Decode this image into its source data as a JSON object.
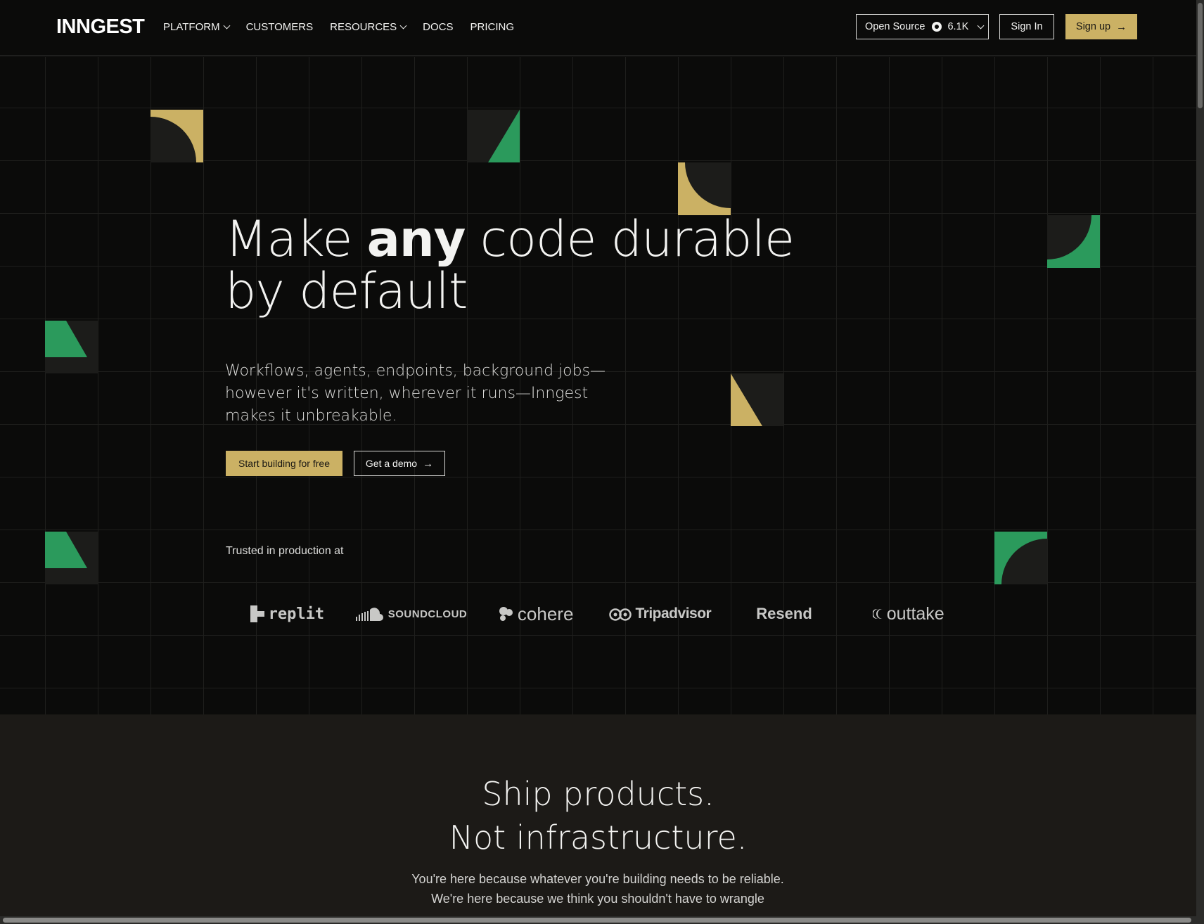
{
  "colors": {
    "gold": "#cbb164",
    "green": "#2b9a5c",
    "tile_dark": "#1c1c1a",
    "page_bg": "#0b0b0a",
    "section_bg": "#1c1a17"
  },
  "nav": {
    "logo": "INNGEST",
    "links": [
      {
        "label": "PLATFORM",
        "dropdown": true
      },
      {
        "label": "CUSTOMERS",
        "dropdown": false
      },
      {
        "label": "RESOURCES",
        "dropdown": true
      },
      {
        "label": "DOCS",
        "dropdown": false
      },
      {
        "label": "PRICING",
        "dropdown": false
      }
    ],
    "open_source_label": "Open Source",
    "github_stars": "6.1K",
    "github_icon": "github-icon",
    "sign_in": "Sign In",
    "sign_up": "Sign up",
    "arrow": "→"
  },
  "hero": {
    "headline_pre": "Make ",
    "headline_bold": "any",
    "headline_post": " code durable by default",
    "subhead": "Workflows, agents, endpoints, background jobs—however it's written, wherever it runs—Inngest makes it unbreakable.",
    "cta_primary": "Start building for free",
    "cta_secondary": "Get a demo",
    "arrow": "→",
    "trusted_label": "Trusted in production at",
    "brands": [
      "replit",
      "SOUNDCLOUD",
      "cohere",
      "Tripadvisor",
      "Resend",
      "outtake"
    ]
  },
  "section2": {
    "title_line1": "Ship products.",
    "title_line2": "Not infrastructure.",
    "body_line1": "You're here because whatever you're building needs to be reliable.",
    "body_line2": "We're here because we think you shouldn't have to wrangle"
  }
}
